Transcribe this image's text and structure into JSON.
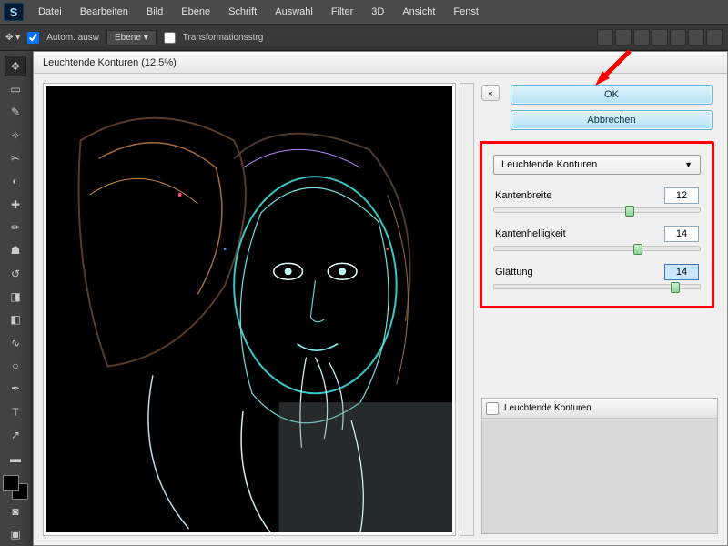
{
  "app": {
    "logo_letter": "S"
  },
  "menu": [
    "Datei",
    "Bearbeiten",
    "Bild",
    "Ebene",
    "Schrift",
    "Auswahl",
    "Filter",
    "3D",
    "Ansicht",
    "Fenst"
  ],
  "options": {
    "auto_select": "Autom. ausw",
    "layer_label": "Ebene",
    "transform_controls": "Transformationsstrg"
  },
  "dialog": {
    "title": "Leuchtende Konturen (12,5%)",
    "ok": "OK",
    "cancel": "Abbrechen",
    "filter_name": "Leuchtende Konturen",
    "sliders": {
      "kantenbreite": {
        "label": "Kantenbreite",
        "value": "12",
        "pos": 66
      },
      "kantenhelligkeit": {
        "label": "Kantenhelligkeit",
        "value": "14",
        "pos": 70
      },
      "glaettung": {
        "label": "Glättung",
        "value": "14",
        "pos": 88
      }
    },
    "layers_panel_item": "Leuchtende Konturen",
    "collapse_glyph": "«"
  }
}
